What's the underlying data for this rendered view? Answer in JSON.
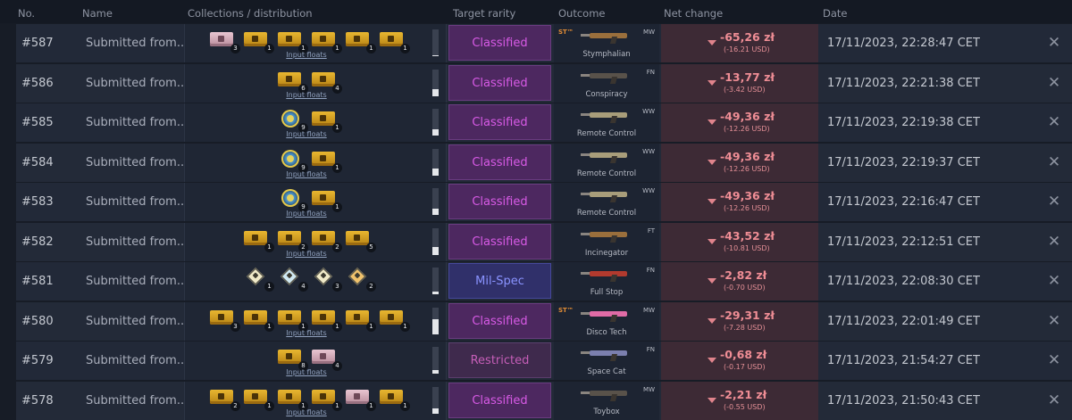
{
  "header": {
    "no": "No.",
    "name": "Name",
    "collections": "Collections / distribution",
    "target_rarity": "Target rarity",
    "outcome": "Outcome",
    "net_change": "Net change",
    "date": "Date"
  },
  "rows": [
    {
      "no": "#587",
      "name": "Submitted from...",
      "cases": [
        {
          "kind": "pink",
          "count": "3"
        },
        {
          "kind": "gold",
          "count": "1"
        },
        {
          "kind": "gold",
          "count": "1"
        },
        {
          "kind": "gold",
          "count": "1"
        },
        {
          "kind": "gold",
          "count": "1"
        },
        {
          "kind": "gold",
          "count": "1"
        }
      ],
      "input_floats": "Input floats",
      "float_fraction": 0.05,
      "target_rarity": "Classified",
      "rarity_class": "classified",
      "outcome": {
        "name": "Stymphalian",
        "wear": "MW",
        "stattrak": "ST™",
        "gun": "wood"
      },
      "net_change": "-65,26 zł",
      "net_usd": "(-16.21 USD)",
      "date": "17/11/2023, 22:28:47 CET"
    },
    {
      "no": "#586",
      "name": "Submitted from...",
      "cases": [
        {
          "kind": "gold",
          "count": "6"
        },
        {
          "kind": "gold",
          "count": "4"
        }
      ],
      "input_floats": "Input floats",
      "float_fraction": 0.25,
      "target_rarity": "Classified",
      "rarity_class": "classified",
      "outcome": {
        "name": "Conspiracy",
        "wear": "FN",
        "stattrak": "",
        "gun": "grey"
      },
      "net_change": "-13,77 zł",
      "net_usd": "(-3.42 USD)",
      "date": "17/11/2023, 22:21:38 CET"
    },
    {
      "no": "#585",
      "name": "Submitted from...",
      "cases": [
        {
          "kind": "coin",
          "count": "9"
        },
        {
          "kind": "gold",
          "count": "1"
        }
      ],
      "input_floats": "Input floats",
      "float_fraction": 0.25,
      "target_rarity": "Classified",
      "rarity_class": "classified",
      "outcome": {
        "name": "Remote Control",
        "wear": "WW",
        "stattrak": "",
        "gun": "tan"
      },
      "net_change": "-49,36 zł",
      "net_usd": "(-12.26 USD)",
      "date": "17/11/2023, 22:19:38 CET"
    },
    {
      "no": "#584",
      "name": "Submitted from...",
      "cases": [
        {
          "kind": "coin",
          "count": "9"
        },
        {
          "kind": "gold",
          "count": "1"
        }
      ],
      "input_floats": "Input floats",
      "float_fraction": 0.25,
      "target_rarity": "Classified",
      "rarity_class": "classified",
      "outcome": {
        "name": "Remote Control",
        "wear": "WW",
        "stattrak": "",
        "gun": "tan"
      },
      "net_change": "-49,36 zł",
      "net_usd": "(-12.26 USD)",
      "date": "17/11/2023, 22:19:37 CET"
    },
    {
      "no": "#583",
      "name": "Submitted from...",
      "cases": [
        {
          "kind": "coin",
          "count": "9"
        },
        {
          "kind": "gold",
          "count": "1"
        }
      ],
      "input_floats": "Input floats",
      "float_fraction": 0.25,
      "target_rarity": "Classified",
      "rarity_class": "classified",
      "outcome": {
        "name": "Remote Control",
        "wear": "WW",
        "stattrak": "",
        "gun": "tan"
      },
      "net_change": "-49,36 zł",
      "net_usd": "(-12.26 USD)",
      "date": "17/11/2023, 22:16:47 CET"
    },
    {
      "no": "#582",
      "name": "Submitted from...",
      "cases": [
        {
          "kind": "gold",
          "count": "1"
        },
        {
          "kind": "gold",
          "count": "2"
        },
        {
          "kind": "gold",
          "count": "2"
        },
        {
          "kind": "gold",
          "count": "5"
        }
      ],
      "input_floats": "Input floats",
      "float_fraction": 0.3,
      "target_rarity": "Classified",
      "rarity_class": "classified",
      "outcome": {
        "name": "Incinegator",
        "wear": "FT",
        "stattrak": "",
        "gun": "wood"
      },
      "net_change": "-43,52 zł",
      "net_usd": "(-10.81 USD)",
      "date": "17/11/2023, 22:12:51 CET"
    },
    {
      "no": "#581",
      "name": "Submitted from...",
      "cases": [
        {
          "kind": "dia",
          "count": "1"
        },
        {
          "kind": "dia cyan",
          "count": "4"
        },
        {
          "kind": "dia",
          "count": "3"
        },
        {
          "kind": "dia orange",
          "count": "2"
        }
      ],
      "input_floats": "",
      "float_fraction": 0.1,
      "target_rarity": "Mil-Spec",
      "rarity_class": "milspec",
      "outcome": {
        "name": "Full Stop",
        "wear": "FN",
        "stattrak": "",
        "gun": "red"
      },
      "net_change": "-2,82 zł",
      "net_usd": "(-0.70 USD)",
      "date": "17/11/2023, 22:08:30 CET"
    },
    {
      "no": "#580",
      "name": "Submitted from...",
      "cases": [
        {
          "kind": "gold",
          "count": "3"
        },
        {
          "kind": "gold",
          "count": "1"
        },
        {
          "kind": "gold",
          "count": "1"
        },
        {
          "kind": "gold",
          "count": "1"
        },
        {
          "kind": "gold",
          "count": "1"
        },
        {
          "kind": "gold",
          "count": "1"
        }
      ],
      "input_floats": "Input floats",
      "float_fraction": 0.55,
      "target_rarity": "Classified",
      "rarity_class": "classified",
      "outcome": {
        "name": "Disco Tech",
        "wear": "MW",
        "stattrak": "ST™",
        "gun": "pink"
      },
      "net_change": "-29,31 zł",
      "net_usd": "(-7.28 USD)",
      "date": "17/11/2023, 22:01:49 CET"
    },
    {
      "no": "#579",
      "name": "Submitted from...",
      "cases": [
        {
          "kind": "gold",
          "count": "8"
        },
        {
          "kind": "pink",
          "count": "4"
        }
      ],
      "input_floats": "Input floats",
      "float_fraction": 0.15,
      "target_rarity": "Restricted",
      "rarity_class": "restricted",
      "outcome": {
        "name": "Space Cat",
        "wear": "FN",
        "stattrak": "",
        "gun": "blue"
      },
      "net_change": "-0,68 zł",
      "net_usd": "(-0.17 USD)",
      "date": "17/11/2023, 21:54:27 CET"
    },
    {
      "no": "#578",
      "name": "Submitted from...",
      "cases": [
        {
          "kind": "gold",
          "count": "2"
        },
        {
          "kind": "gold",
          "count": "1"
        },
        {
          "kind": "gold",
          "count": "1"
        },
        {
          "kind": "gold",
          "count": "1"
        },
        {
          "kind": "pink",
          "count": "1"
        },
        {
          "kind": "gold",
          "count": "1"
        }
      ],
      "input_floats": "Input floats",
      "float_fraction": 0.2,
      "target_rarity": "Classified",
      "rarity_class": "classified",
      "outcome": {
        "name": "Toybox",
        "wear": "MW",
        "stattrak": "",
        "gun": "grey"
      },
      "net_change": "-2,21 zł",
      "net_usd": "(-0.55 USD)",
      "date": "17/11/2023, 21:50:43 CET"
    }
  ],
  "icons": {
    "delete": "close-icon",
    "case": "case-icon",
    "net_down": "arrow-down-icon"
  },
  "colors": {
    "classified": "#d85ae6",
    "milspec": "#8a93ff",
    "restricted": "#c65eb8",
    "net_negative": "#ef8d95"
  }
}
